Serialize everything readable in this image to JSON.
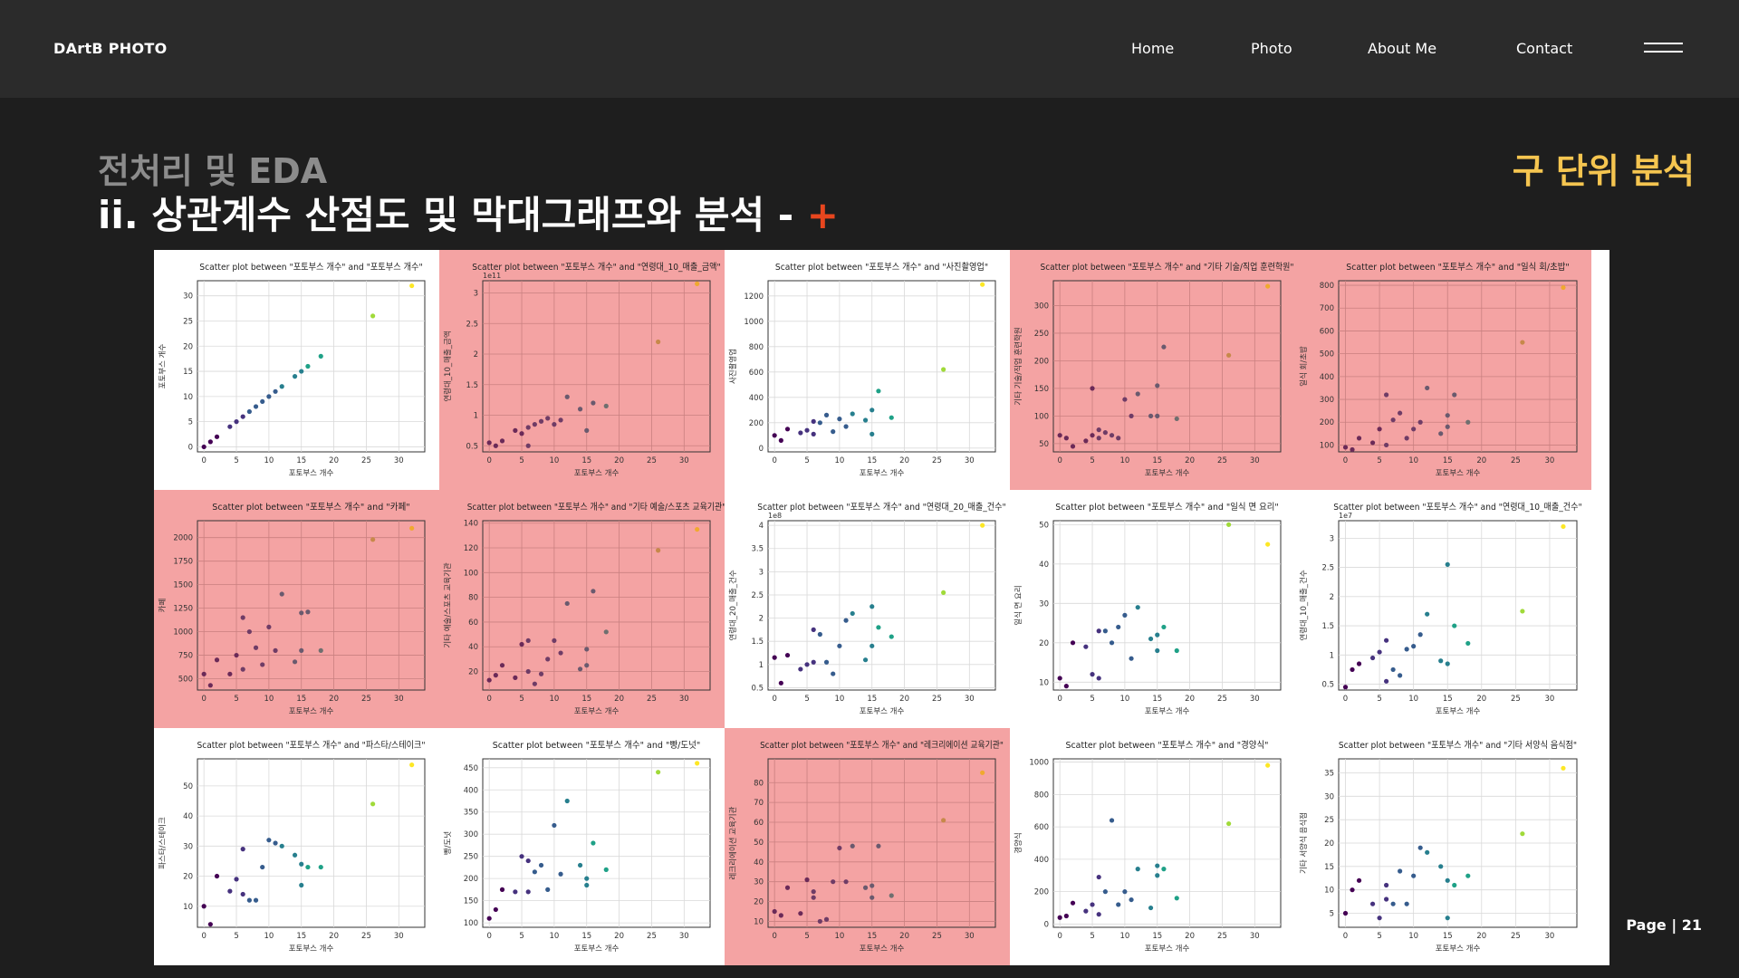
{
  "nav": {
    "brand": "DArtB PHOTO",
    "links": [
      "Home",
      "Photo",
      "About Me",
      "Contact"
    ]
  },
  "heading": {
    "section": "전처리 및 EDA",
    "title": "ii. 상관계수 산점도 및 막대그래프와 분석 - ",
    "plus": "+",
    "unit": "구 단위 분석"
  },
  "footer": {
    "page": "Page | 21"
  },
  "colors": {
    "highlight": "#f4a3a3",
    "accent_plus": "#e8461e",
    "accent_unit": "#f5c550"
  },
  "chart_data": [
    {
      "type": "scatter",
      "highlight": false,
      "title": "Scatter plot between \"포토부스 개수\" and \"포토부스 개수\"",
      "xlabel": "포토부스 개수",
      "ylabel": "포토부스 개수",
      "offset": "",
      "xlim": [
        -1,
        34
      ],
      "ylim": [
        -1,
        33
      ],
      "yticks": [
        0,
        5,
        10,
        15,
        20,
        25,
        30
      ],
      "x": [
        0,
        1,
        2,
        4,
        5,
        6,
        7,
        8,
        9,
        10,
        11,
        12,
        14,
        15,
        16,
        18,
        26,
        32
      ],
      "y": [
        0,
        1,
        2,
        4,
        5,
        6,
        7,
        8,
        9,
        10,
        11,
        12,
        14,
        15,
        16,
        18,
        26,
        32
      ]
    },
    {
      "type": "scatter",
      "highlight": true,
      "title": "Scatter plot between \"포토부스 개수\" and \"연령대_10_매출_금액\"",
      "xlabel": "포토부스 개수",
      "ylabel": "연령대_10_매출_금액",
      "offset": "1e11",
      "xlim": [
        -1,
        34
      ],
      "ylim": [
        0.4,
        3.2
      ],
      "yticks": [
        0.5,
        1.0,
        1.5,
        2.0,
        2.5,
        3.0
      ],
      "x": [
        0,
        1,
        2,
        4,
        5,
        6,
        6,
        7,
        8,
        9,
        10,
        11,
        12,
        14,
        15,
        16,
        18,
        26,
        32
      ],
      "y": [
        0.55,
        0.5,
        0.58,
        0.75,
        0.7,
        0.8,
        0.5,
        0.85,
        0.9,
        0.95,
        0.85,
        0.92,
        1.3,
        1.1,
        0.75,
        1.2,
        1.15,
        2.2,
        3.15
      ]
    },
    {
      "type": "scatter",
      "highlight": false,
      "title": "Scatter plot between \"포토부스 개수\" and \"사진촬영업\"",
      "xlabel": "포토부스 개수",
      "ylabel": "사진촬영업",
      "offset": "",
      "xlim": [
        -1,
        34
      ],
      "ylim": [
        -30,
        1320
      ],
      "yticks": [
        0,
        200,
        400,
        600,
        800,
        1000,
        1200
      ],
      "x": [
        0,
        1,
        2,
        4,
        5,
        6,
        6,
        7,
        8,
        9,
        10,
        11,
        12,
        14,
        15,
        15,
        16,
        18,
        26,
        32
      ],
      "y": [
        100,
        60,
        150,
        120,
        140,
        110,
        210,
        200,
        260,
        130,
        230,
        170,
        270,
        220,
        300,
        110,
        450,
        240,
        620,
        1290
      ]
    },
    {
      "type": "scatter",
      "highlight": true,
      "title": "Scatter plot between \"포토부스 개수\" and \"기타 기술/직업 훈련학원\"",
      "xlabel": "포토부스 개수",
      "ylabel": "기타 기술/직업 훈련학원",
      "offset": "",
      "xlim": [
        -1,
        34
      ],
      "ylim": [
        35,
        345
      ],
      "yticks": [
        50,
        100,
        150,
        200,
        250,
        300
      ],
      "x": [
        0,
        1,
        2,
        4,
        5,
        5,
        6,
        6,
        7,
        8,
        9,
        10,
        11,
        12,
        14,
        15,
        15,
        16,
        18,
        26,
        32
      ],
      "y": [
        65,
        60,
        45,
        55,
        65,
        150,
        60,
        75,
        70,
        65,
        60,
        130,
        100,
        140,
        100,
        155,
        100,
        225,
        95,
        210,
        335
      ]
    },
    {
      "type": "scatter",
      "highlight": true,
      "title": "Scatter plot between \"포토부스 개수\" and \"일식 회/초밥\"",
      "xlabel": "포토부스 개수",
      "ylabel": "일식 회/초밥",
      "offset": "",
      "xlim": [
        -1,
        34
      ],
      "ylim": [
        70,
        820
      ],
      "yticks": [
        100,
        200,
        300,
        400,
        500,
        600,
        700,
        800
      ],
      "x": [
        0,
        1,
        2,
        4,
        5,
        6,
        6,
        7,
        8,
        9,
        10,
        11,
        12,
        14,
        15,
        15,
        16,
        18,
        26,
        32
      ],
      "y": [
        90,
        80,
        130,
        110,
        170,
        100,
        320,
        210,
        240,
        130,
        170,
        200,
        350,
        150,
        230,
        180,
        320,
        200,
        550,
        790
      ]
    },
    {
      "type": "scatter",
      "highlight": true,
      "title": "Scatter plot between \"포토부스 개수\" and \"카페\"",
      "xlabel": "포토부스 개수",
      "ylabel": "카페",
      "offset": "",
      "xlim": [
        -1,
        34
      ],
      "ylim": [
        380,
        2180
      ],
      "yticks": [
        500,
        750,
        1000,
        1250,
        1500,
        1750,
        2000
      ],
      "x": [
        0,
        1,
        2,
        4,
        5,
        6,
        6,
        7,
        8,
        9,
        10,
        11,
        12,
        14,
        15,
        15,
        16,
        18,
        26,
        32
      ],
      "y": [
        550,
        430,
        700,
        550,
        750,
        600,
        1150,
        1000,
        830,
        650,
        1050,
        800,
        1400,
        680,
        800,
        1200,
        1210,
        800,
        1980,
        2100
      ]
    },
    {
      "type": "scatter",
      "highlight": true,
      "title": "Scatter plot between \"포토부스 개수\" and \"기타 예술/스포츠 교육기관\"",
      "xlabel": "포토부스 개수",
      "ylabel": "기타 예술/스포츠 교육기관",
      "offset": "",
      "xlim": [
        -1,
        34
      ],
      "ylim": [
        5,
        142
      ],
      "yticks": [
        20,
        40,
        60,
        80,
        100,
        120,
        140
      ],
      "x": [
        0,
        1,
        2,
        4,
        5,
        6,
        6,
        7,
        8,
        9,
        10,
        11,
        12,
        14,
        15,
        15,
        16,
        18,
        26,
        32
      ],
      "y": [
        13,
        17,
        25,
        15,
        42,
        20,
        45,
        10,
        18,
        30,
        45,
        35,
        75,
        22,
        38,
        25,
        85,
        52,
        118,
        135
      ]
    },
    {
      "type": "scatter",
      "highlight": false,
      "title": "Scatter plot between \"포토부스 개수\" and \"연령대_20_매출_건수\"",
      "xlabel": "포토부스 개수",
      "ylabel": "연령대_20_매출_건수",
      "offset": "1e8",
      "xlim": [
        -1,
        34
      ],
      "ylim": [
        0.45,
        4.1
      ],
      "yticks": [
        0.5,
        1.0,
        1.5,
        2.0,
        2.5,
        3.0,
        3.5,
        4.0
      ],
      "x": [
        0,
        1,
        2,
        4,
        5,
        6,
        6,
        7,
        8,
        9,
        10,
        11,
        12,
        14,
        15,
        15,
        16,
        18,
        26,
        32
      ],
      "y": [
        1.15,
        0.6,
        1.2,
        0.9,
        1.0,
        1.75,
        1.05,
        1.65,
        1.05,
        0.8,
        1.4,
        1.95,
        2.1,
        1.1,
        2.25,
        1.4,
        1.8,
        1.6,
        2.55,
        4.0
      ]
    },
    {
      "type": "scatter",
      "highlight": false,
      "title": "Scatter plot between \"포토부스 개수\" and \"일식 면 요리\"",
      "xlabel": "포토부스 개수",
      "ylabel": "일식 면 요리",
      "offset": "",
      "xlim": [
        -1,
        34
      ],
      "ylim": [
        8,
        51
      ],
      "yticks": [
        10,
        20,
        30,
        40,
        50
      ],
      "x": [
        0,
        1,
        2,
        4,
        5,
        6,
        6,
        7,
        8,
        9,
        10,
        11,
        12,
        14,
        15,
        15,
        16,
        18,
        26,
        32
      ],
      "y": [
        11,
        9,
        20,
        19,
        12,
        23,
        11,
        23,
        20,
        24,
        27,
        16,
        29,
        21,
        22,
        18,
        24,
        18,
        50,
        45
      ]
    },
    {
      "type": "scatter",
      "highlight": false,
      "title": "Scatter plot between \"포토부스 개수\" and \"연령대_10_매출_건수\"",
      "xlabel": "포토부스 개수",
      "ylabel": "연령대_10_매출_건수",
      "offset": "1e7",
      "xlim": [
        -1,
        34
      ],
      "ylim": [
        0.4,
        3.3
      ],
      "yticks": [
        0.5,
        1.0,
        1.5,
        2.0,
        2.5,
        3.0
      ],
      "x": [
        0,
        1,
        2,
        4,
        5,
        6,
        6,
        7,
        8,
        9,
        10,
        11,
        12,
        14,
        15,
        15,
        16,
        18,
        26,
        32
      ],
      "y": [
        0.45,
        0.75,
        0.85,
        0.95,
        1.05,
        1.25,
        0.55,
        0.75,
        0.65,
        1.1,
        1.15,
        1.35,
        1.7,
        0.9,
        2.55,
        0.85,
        1.5,
        1.2,
        1.75,
        3.2
      ]
    },
    {
      "type": "scatter",
      "highlight": false,
      "title": "Scatter plot between \"포토부스 개수\" and \"파스타/스테이크\"",
      "xlabel": "포토부스 개수",
      "ylabel": "파스타/스테이크",
      "offset": "",
      "xlim": [
        -1,
        34
      ],
      "ylim": [
        3,
        59
      ],
      "yticks": [
        10,
        20,
        30,
        40,
        50
      ],
      "x": [
        0,
        1,
        2,
        4,
        5,
        6,
        6,
        7,
        8,
        9,
        10,
        11,
        12,
        14,
        15,
        15,
        16,
        18,
        26,
        32
      ],
      "y": [
        10,
        4,
        20,
        15,
        19,
        29,
        14,
        12,
        12,
        23,
        32,
        31,
        30,
        27,
        24,
        17,
        23,
        23,
        44,
        57
      ]
    },
    {
      "type": "scatter",
      "highlight": false,
      "title": "Scatter plot between \"포토부스 개수\" and \"빵/도넛\"",
      "xlabel": "포토부스 개수",
      "ylabel": "빵/도넛",
      "offset": "",
      "xlim": [
        -1,
        34
      ],
      "ylim": [
        90,
        470
      ],
      "yticks": [
        100,
        150,
        200,
        250,
        300,
        350,
        400,
        450
      ],
      "x": [
        0,
        1,
        2,
        4,
        5,
        6,
        6,
        7,
        8,
        9,
        10,
        11,
        12,
        14,
        15,
        15,
        16,
        18,
        26,
        32
      ],
      "y": [
        110,
        130,
        175,
        170,
        250,
        170,
        240,
        215,
        230,
        175,
        320,
        210,
        375,
        230,
        185,
        200,
        280,
        220,
        440,
        460
      ]
    },
    {
      "type": "scatter",
      "highlight": true,
      "title": "Scatter plot between \"포토부스 개수\" and \"레크리에이션 교육기관\"",
      "xlabel": "포토부스 개수",
      "ylabel": "레크리에이션 교육기관",
      "offset": "",
      "xlim": [
        -1,
        34
      ],
      "ylim": [
        7,
        92
      ],
      "yticks": [
        10,
        20,
        30,
        40,
        50,
        60,
        70,
        80
      ],
      "x": [
        0,
        1,
        2,
        4,
        5,
        6,
        6,
        7,
        8,
        9,
        10,
        11,
        12,
        14,
        15,
        15,
        16,
        18,
        26,
        32
      ],
      "y": [
        15,
        13,
        27,
        14,
        31,
        25,
        22,
        10,
        11,
        30,
        47,
        30,
        48,
        27,
        28,
        22,
        48,
        23,
        61,
        85
      ]
    },
    {
      "type": "scatter",
      "highlight": false,
      "title": "Scatter plot between \"포토부스 개수\" and \"경양식\"",
      "xlabel": "포토부스 개수",
      "ylabel": "경양식",
      "offset": "",
      "xlim": [
        -1,
        34
      ],
      "ylim": [
        -20,
        1020
      ],
      "yticks": [
        0,
        200,
        400,
        600,
        800,
        1000
      ],
      "x": [
        0,
        1,
        2,
        4,
        5,
        6,
        6,
        7,
        8,
        9,
        10,
        11,
        12,
        14,
        15,
        15,
        16,
        18,
        26,
        32
      ],
      "y": [
        40,
        50,
        130,
        80,
        120,
        290,
        60,
        200,
        640,
        120,
        200,
        150,
        340,
        100,
        360,
        300,
        340,
        160,
        620,
        980
      ]
    },
    {
      "type": "scatter",
      "highlight": false,
      "title": "Scatter plot between \"포토부스 개수\" and \"기타 서양식 음식점\"",
      "xlabel": "포토부스 개수",
      "ylabel": "기타 서양식 음식점",
      "offset": "",
      "xlim": [
        -1,
        34
      ],
      "ylim": [
        2,
        38
      ],
      "yticks": [
        5,
        10,
        15,
        20,
        25,
        30,
        35
      ],
      "x": [
        0,
        1,
        2,
        4,
        5,
        6,
        6,
        7,
        8,
        9,
        10,
        11,
        12,
        14,
        15,
        15,
        16,
        18,
        26,
        32
      ],
      "y": [
        5,
        10,
        12,
        7,
        4,
        11,
        8,
        7,
        14,
        7,
        13,
        19,
        18,
        15,
        12,
        4,
        11,
        13,
        22,
        36
      ]
    }
  ]
}
